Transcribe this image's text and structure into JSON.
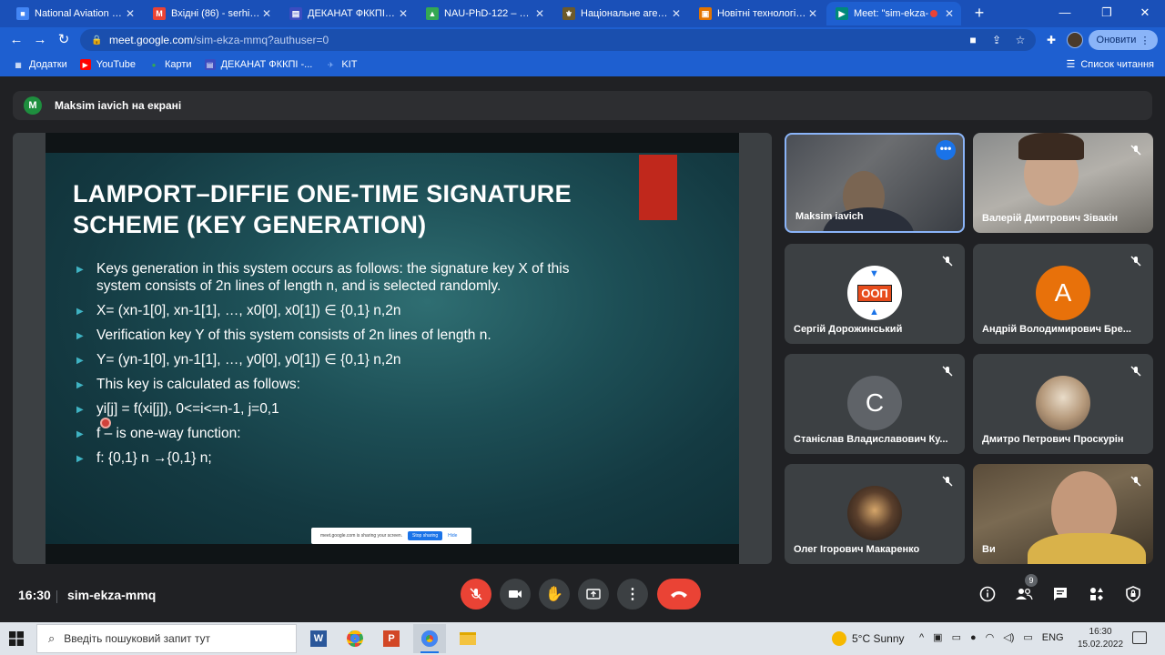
{
  "browser": {
    "tabs": [
      {
        "title": "National Aviation Univ",
        "color": "#4285f4",
        "glyph": "■"
      },
      {
        "title": "Вхідні (86) - serhii.hna",
        "color": "#ea4335",
        "glyph": "M"
      },
      {
        "title": "ДЕКАНАТ ФККПІ - Жу",
        "color": "#3b4cc0",
        "glyph": "▤"
      },
      {
        "title": "NAU-PhD-122 – Goog",
        "color": "#34a853",
        "glyph": "▲"
      },
      {
        "title": "Національне агентст",
        "color": "#6d5a2a",
        "glyph": "⚜"
      },
      {
        "title": "Новітні технології за",
        "color": "#e37400",
        "glyph": "▣"
      },
      {
        "title": "Meet: \"sim-ekza-",
        "color": "#00897b",
        "glyph": "▶"
      }
    ],
    "url_host": "meet.google.com",
    "url_path": "/sim-ekza-mmq?authuser=0",
    "update_label": "Оновити",
    "bookmarks": [
      {
        "label": "Додатки",
        "icon": "apps-grid-icon"
      },
      {
        "label": "YouTube",
        "icon": "youtube-icon"
      },
      {
        "label": "Карти",
        "icon": "maps-icon"
      },
      {
        "label": "ДЕКАНАТ ФККПІ -...",
        "icon": "deanery-icon"
      },
      {
        "label": "KIT",
        "icon": "plane-icon"
      }
    ],
    "reading_list": "Список читання"
  },
  "meet": {
    "presenter_initial": "M",
    "presenter_text": "Maksim iavich на екрані",
    "slide": {
      "title": "LAMPORT–DIFFIE ONE-TIME SIGNATURE SCHEME (KEY GENERATION)",
      "bullets": [
        "Keys generation in this system occurs as follows: the signature key X of this system consists of 2n lines of length n, and is selected randomly.",
        "X= (xn-1[0], xn-1[1], …, x0[0], x0[1]) ∈ {0,1} n,2n",
        "Verification key Y of this system consists of 2n lines of length n.",
        "Y= (yn-1[0], yn-1[1], …, y0[0], y0[1]) ∈ {0,1} n,2n",
        "This key is calculated as follows:",
        "yi[j] = f(xi[j]), 0<=i<=n-1, j=0,1",
        "f – is one-way function:",
        "f: {0,1} n →{0,1} n;"
      ],
      "share_text": "meet.google.com is sharing your screen.",
      "stop_sharing": "Stop sharing",
      "hide": "Hide"
    },
    "participants": [
      {
        "name": "Maksim iavich",
        "type": "video"
      },
      {
        "name": "Валерій Дмитрович Зівакін",
        "type": "video"
      },
      {
        "name": "Сергій Дорожинський",
        "type": "logo",
        "logo_text": "ООП"
      },
      {
        "name": "Андрій Володимирович Бре...",
        "type": "letter",
        "letter": "А",
        "color": "#e8710a"
      },
      {
        "name": "Станіслав Владиславович Ку...",
        "type": "letter",
        "letter": "C",
        "color": "#5f6368"
      },
      {
        "name": "Дмитро Петрович Проскурін",
        "type": "photo"
      },
      {
        "name": "Олег Ігорович Макаренко",
        "type": "photo"
      },
      {
        "name": "Ви",
        "type": "video"
      }
    ],
    "time": "16:30",
    "meeting_code": "sim-ekza-mmq",
    "participant_count": "9"
  },
  "taskbar": {
    "search_placeholder": "Введіть пошуковий запит тут",
    "weather": "5°C  Sunny",
    "language": "ENG",
    "time": "16:30",
    "date": "15.02.2022"
  }
}
